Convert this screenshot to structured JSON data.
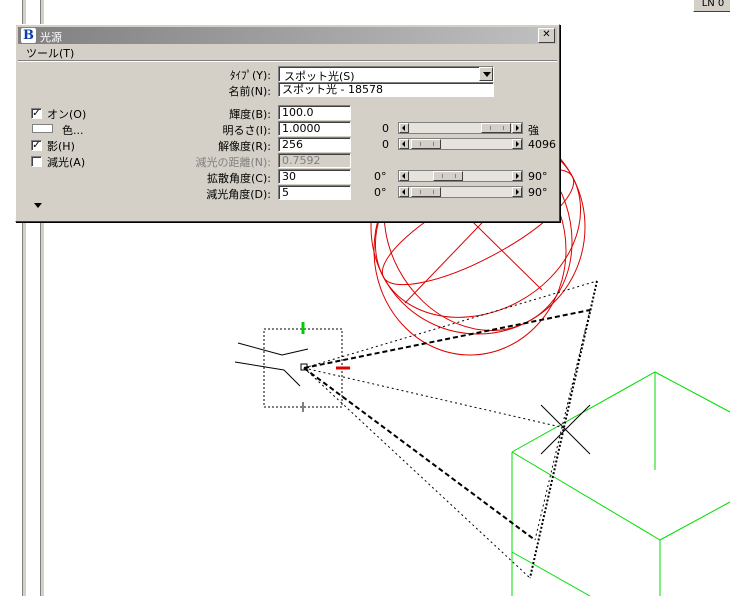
{
  "corner_button": "LN 0",
  "dialog": {
    "title": "光源",
    "close_glyph": "✕",
    "app_icon_glyph": "B",
    "menu_tool": "ツール(T)",
    "type_label": "ﾀｲﾌﾟ(Y):",
    "type_value": "スポット光(S)",
    "name_label": "名前(N):",
    "name_value": "スポット光 - 18578",
    "on_label": "オン(O)",
    "on_checked": "✓",
    "color_label": "色...",
    "shadow_label": "影(H)",
    "shadow_checked": "✓",
    "attenuate_label": "減光(A)",
    "attenuate_checked": "",
    "brightness_label": "輝度(B):",
    "brightness_value": "100.0",
    "intensity_label": "明るさ(I):",
    "intensity_value": "1.0000",
    "intensity_min": "0",
    "intensity_max": "強",
    "resolution_label": "解像度(R):",
    "resolution_value": "256",
    "resolution_min": "0",
    "resolution_max": "4096",
    "falloff_label": "減光の距離(N):",
    "falloff_value": "0.7592",
    "spread_label": "拡散角度(C):",
    "spread_value": "30",
    "spread_min": "0°",
    "spread_max": "90°",
    "decay_label": "減光角度(D):",
    "decay_value": "5",
    "decay_min": "0°",
    "decay_max": "90°"
  },
  "colors": {
    "sphere": "#dd0000",
    "cube": "#00dd00",
    "cone": "#000000",
    "dialog_bg": "#d4d0c8"
  }
}
